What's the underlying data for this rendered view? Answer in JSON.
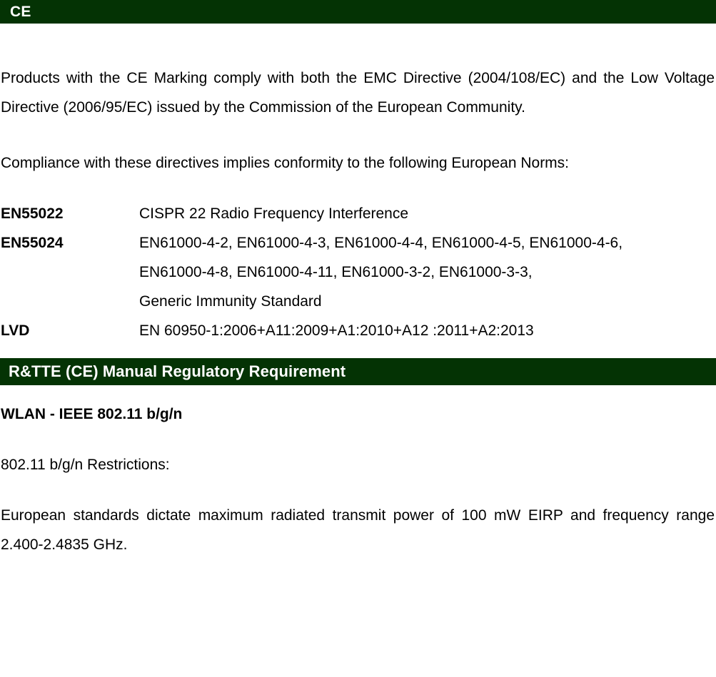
{
  "colors": {
    "banner_background": "#043304",
    "banner_text": "#ffffff",
    "body_text": "#000000",
    "page_background": "#ffffff"
  },
  "sections": {
    "ce": {
      "banner_title": "CE",
      "paragraph_1": "Products with the CE Marking comply with both the EMC Directive (2004/108/EC) and the Low Voltage Directive (2006/95/EC) issued by the Commission of the European Community.",
      "paragraph_2": "Compliance with these directives implies conformity to the following European Norms:",
      "standards": [
        {
          "label": "EN55022",
          "lines": [
            "CISPR 22 Radio Frequency Interference"
          ]
        },
        {
          "label": "EN55024",
          "lines": [
            "EN61000-4-2, EN61000-4-3, EN61000-4-4, EN61000-4-5, EN61000-4-6,",
            "EN61000-4-8, EN61000-4-11, EN61000-3-2, EN61000-3-3,",
            "Generic Immunity Standard"
          ]
        },
        {
          "label": "LVD",
          "lines": [
            "EN 60950-1:2006+A11:2009+A1:2010+A12 :2011+A2:2013"
          ]
        }
      ]
    },
    "rtte": {
      "banner_title": "R&TTE (CE) Manual Regulatory Requirement",
      "wlan_heading": "WLAN - IEEE 802.11 b/g/n",
      "restrictions_heading": "802.11 b/g/n Restrictions:",
      "paragraph_1": "European standards dictate maximum radiated transmit power of 100 mW EIRP and frequency range 2.400-2.4835 GHz."
    }
  }
}
